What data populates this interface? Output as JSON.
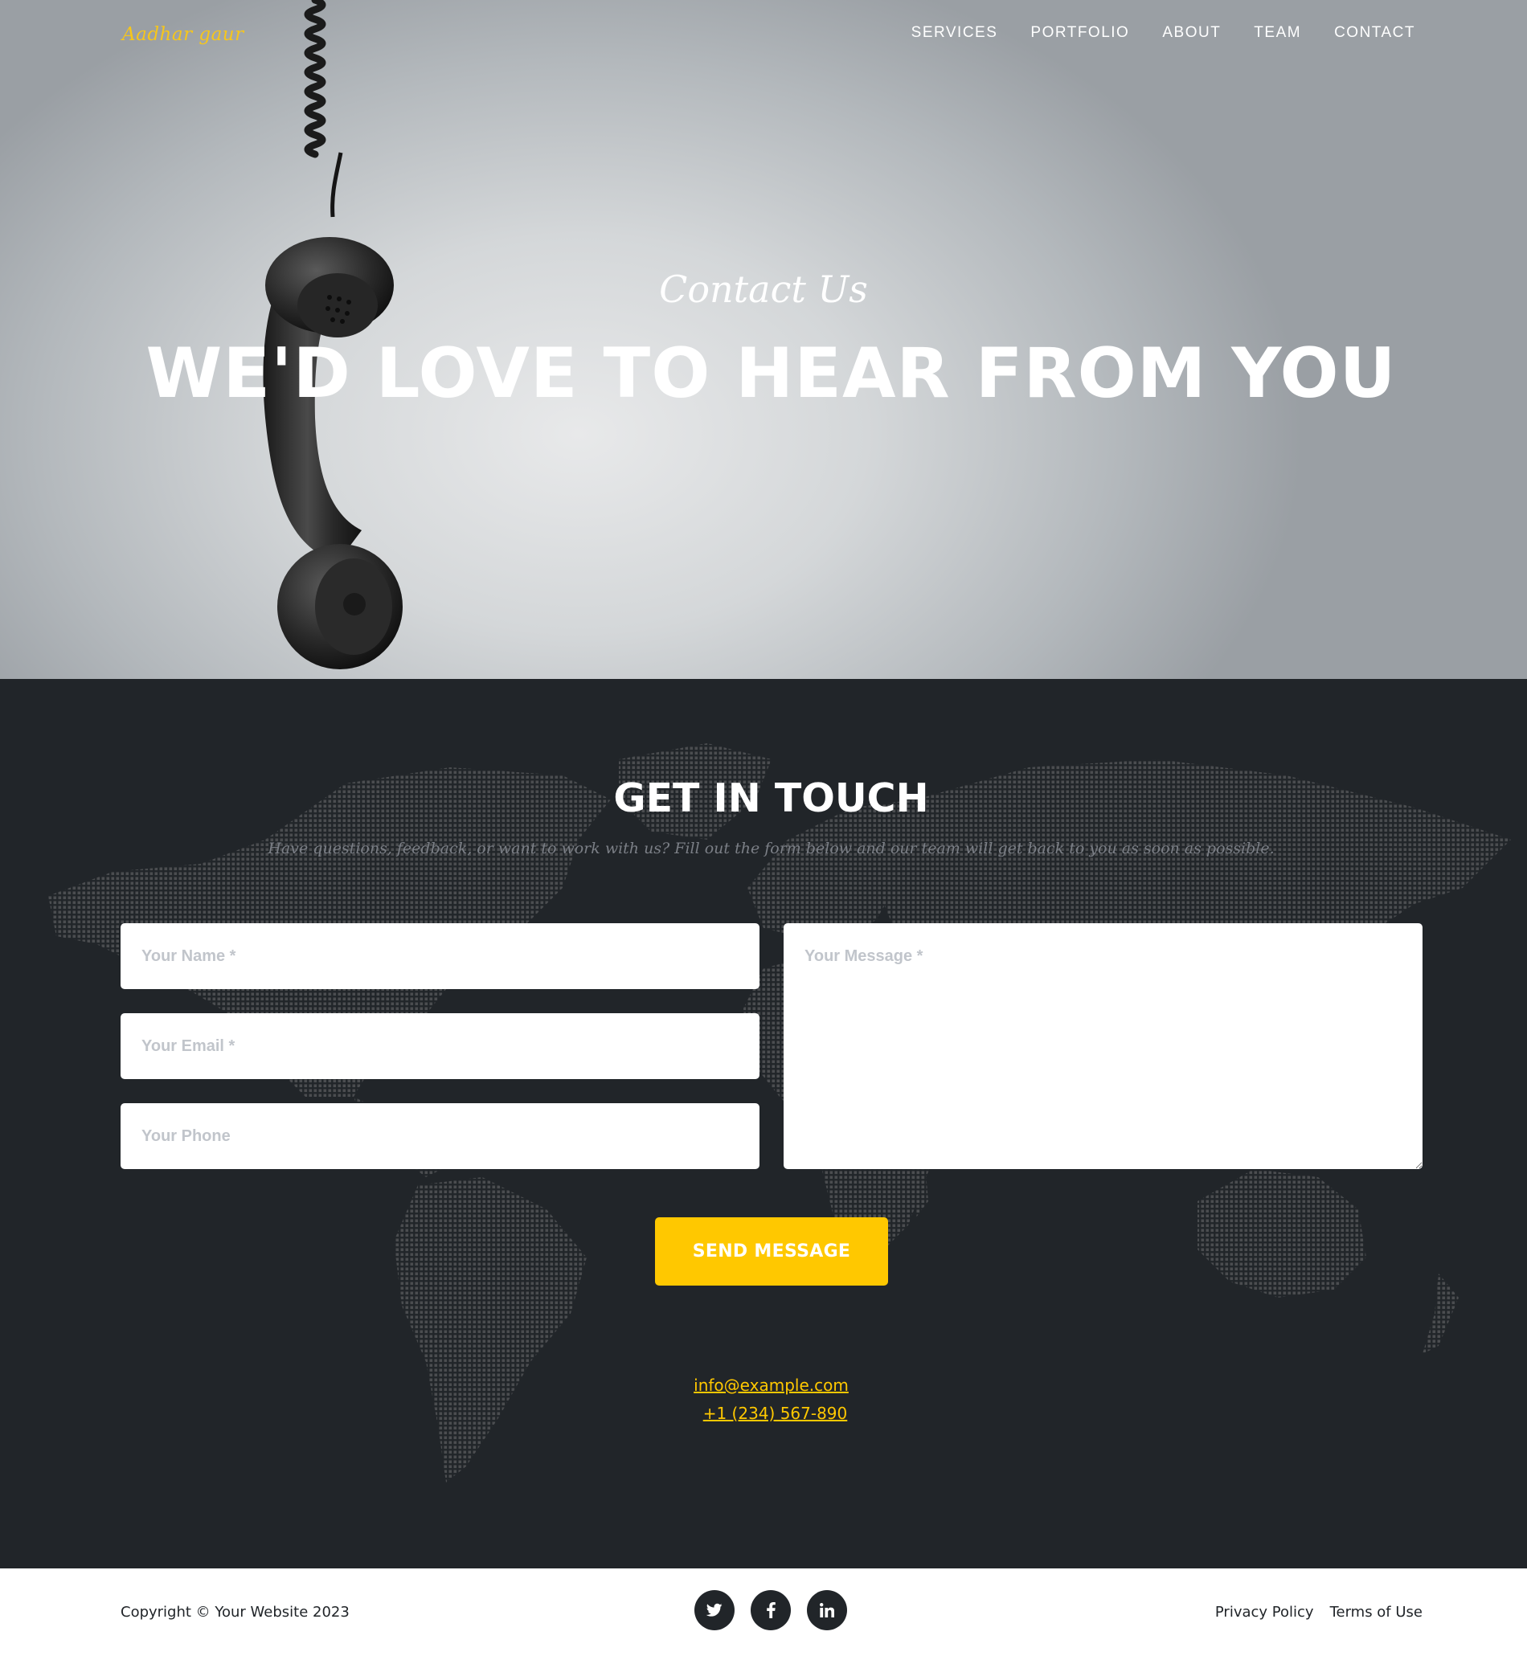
{
  "brand": {
    "logo_text": "Aadhar gaur"
  },
  "nav": {
    "items": [
      {
        "label": "SERVICES"
      },
      {
        "label": "PORTFOLIO"
      },
      {
        "label": "ABOUT"
      },
      {
        "label": "TEAM"
      },
      {
        "label": "CONTACT"
      }
    ]
  },
  "hero": {
    "subheading": "Contact Us",
    "heading": "WE'D LOVE TO HEAR FROM YOU",
    "image_icon": "hanging-telephone-handset"
  },
  "contact": {
    "title": "GET IN TOUCH",
    "lead": "Have questions, feedback, or want to work with us? Fill out the form below and our team will get back to you as soon as possible.",
    "form": {
      "name_placeholder": "Your Name *",
      "email_placeholder": "Your Email *",
      "phone_placeholder": "Your Phone",
      "message_placeholder": "Your Message *",
      "submit_label": "SEND MESSAGE"
    },
    "email": "info@example.com",
    "phone": "+1 (234) 567-890"
  },
  "footer": {
    "copyright": "Copyright © Your Website 2023",
    "social": [
      {
        "icon": "twitter-icon"
      },
      {
        "icon": "facebook-icon"
      },
      {
        "icon": "linkedin-icon"
      }
    ],
    "links": [
      {
        "label": "Privacy Policy"
      },
      {
        "label": "Terms of Use"
      }
    ]
  },
  "colors": {
    "accent": "#ffc800",
    "dark": "#212529",
    "white": "#ffffff"
  }
}
